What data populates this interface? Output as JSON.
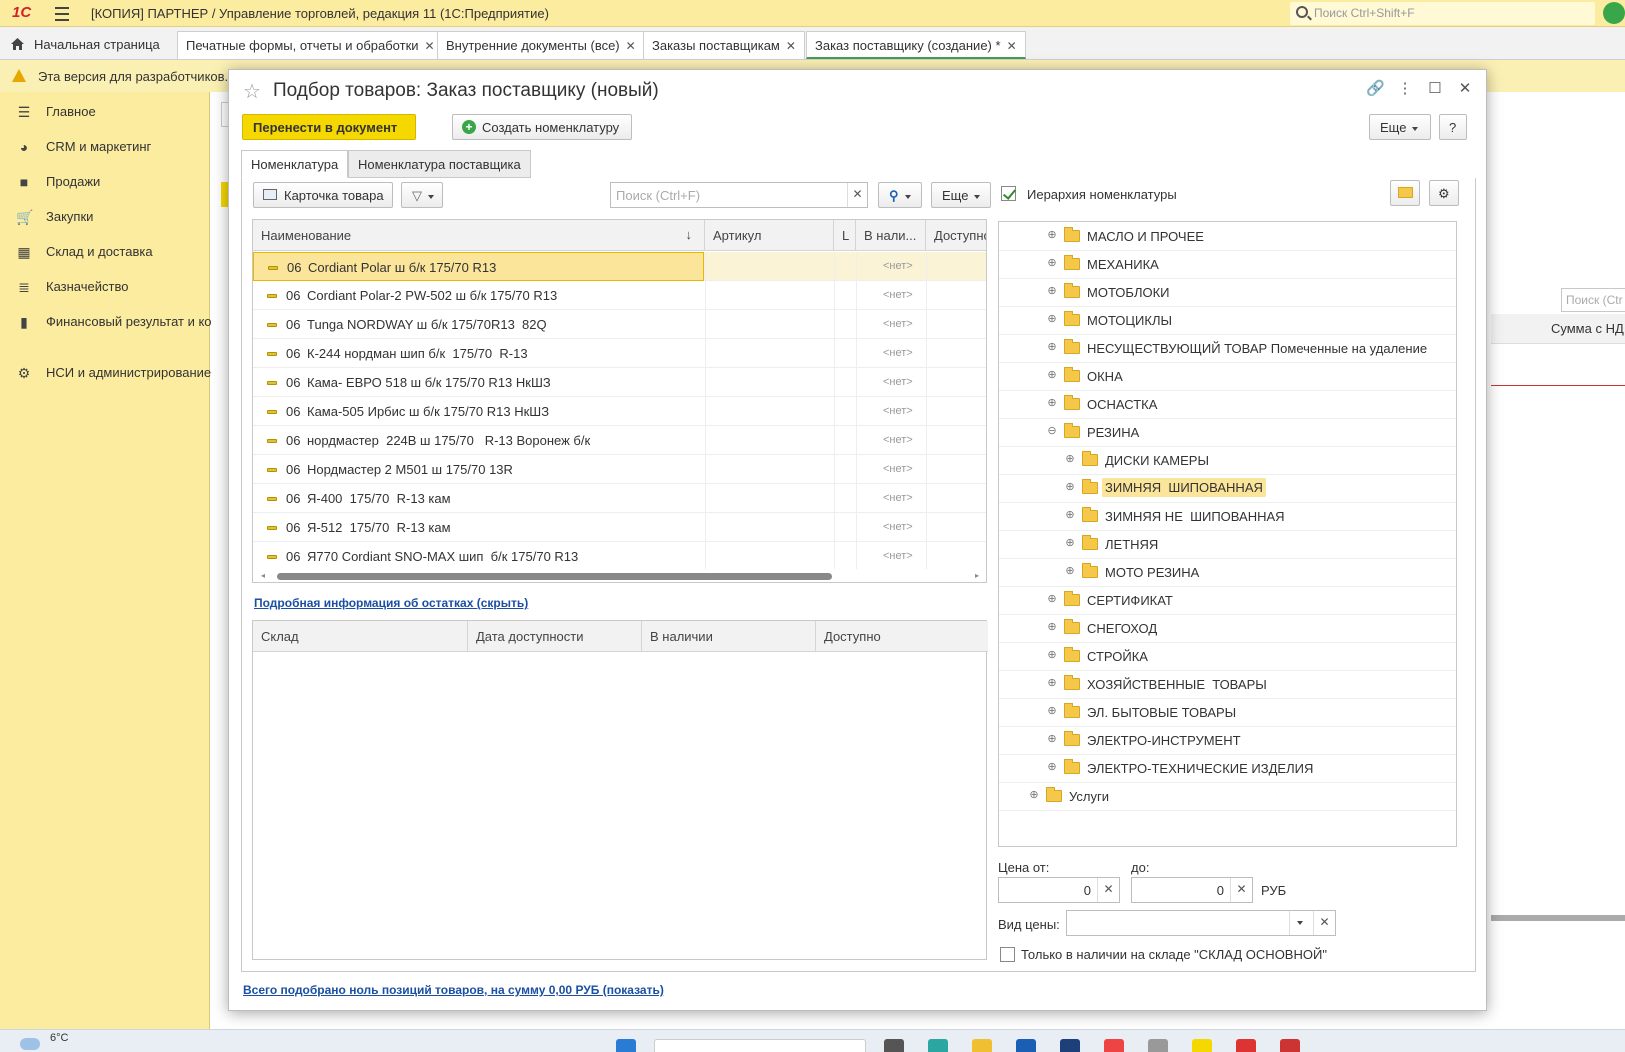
{
  "window": {
    "logo": "1С",
    "title": "[КОПИЯ] ПАРТНЕР / Управление торговлей, редакция 11  (1С:Предприятие)",
    "search_placeholder": "Поиск Ctrl+Shift+F"
  },
  "tabs": {
    "home": "Начальная страница",
    "items": [
      {
        "label": "Печатные формы, отчеты и обработки"
      },
      {
        "label": "Внутренние документы (все)"
      },
      {
        "label": "Заказы поставщикам"
      },
      {
        "label": "Заказ поставщику (создание) *"
      }
    ]
  },
  "dev_notice": "Эта версия для разработчиков.",
  "sidebar": {
    "items": [
      {
        "label": "Главное"
      },
      {
        "label": "CRM и маркетинг"
      },
      {
        "label": "Продажи"
      },
      {
        "label": "Закупки"
      },
      {
        "label": "Склад и доставка"
      },
      {
        "label": "Казначейство"
      },
      {
        "label": "Финансовый результат и контроллинг"
      },
      {
        "label": "НСИ и администрирование"
      }
    ]
  },
  "background": {
    "search_placeholder": "Поиск (Ctr",
    "column": "Сумма с НД"
  },
  "modal": {
    "title": "Подбор товаров: Заказ поставщику (новый)",
    "transfer_button": "Перенести в документ",
    "create_button": "Создать номенклатуру",
    "more_button": "Еще",
    "help_button": "?",
    "tabs": [
      "Номенклатура",
      "Номенклатура поставщика"
    ],
    "card_button": "Карточка товара",
    "search_placeholder": "Поиск (Ctrl+F)",
    "more2": "Еще",
    "hierarchy_label": "Иерархия номенклатуры",
    "grid": {
      "columns": [
        "Наименование",
        "Артикул",
        "L",
        "В нали...",
        "Доступно"
      ],
      "rows": [
        {
          "code": "06",
          "name": "Cordiant Polar ш б/к 175/70 R13",
          "stock": "<нет>"
        },
        {
          "code": "06",
          "name": "Cordiant Polar-2 PW-502 ш б/к 175/70 R13",
          "stock": "<нет>"
        },
        {
          "code": "06",
          "name": "Tunga NORDWAY ш б/к 175/70R13  82Q",
          "stock": "<нет>"
        },
        {
          "code": "06",
          "name": "К-244 нордман шип б/к  175/70  R-13",
          "stock": "<нет>"
        },
        {
          "code": "06",
          "name": "Кама- ЕВРО 518 ш б/к 175/70 R13 НкШЗ",
          "stock": "<нет>"
        },
        {
          "code": "06",
          "name": "Кама-505 Ирбис ш б/к 175/70 R13 НкШЗ",
          "stock": "<нет>"
        },
        {
          "code": "06",
          "name": "нордмастер  224В ш 175/70   R-13 Воронеж б/к",
          "stock": "<нет>"
        },
        {
          "code": "06",
          "name": "Нордмастер 2 М501 ш 175/70 13R",
          "stock": "<нет>"
        },
        {
          "code": "06",
          "name": "Я-400  175/70  R-13 кам",
          "stock": "<нет>"
        },
        {
          "code": "06",
          "name": "Я-512  175/70  R-13 кам",
          "stock": "<нет>"
        },
        {
          "code": "06",
          "name": "Я770 Cordiant SNO-MAX шип  б/к 175/70 R13",
          "stock": "<нет>"
        }
      ]
    },
    "stock_link": "Подробная информация об остатках (скрыть)",
    "stock_columns": [
      "Склад",
      "Дата доступности",
      "В наличии",
      "Доступно"
    ],
    "tree": [
      {
        "label": "МАСЛО И ПРОЧЕЕ",
        "level": 1,
        "state": "plus"
      },
      {
        "label": "МЕХАНИКА",
        "level": 1,
        "state": "plus"
      },
      {
        "label": "МОТОБЛОКИ",
        "level": 1,
        "state": "plus"
      },
      {
        "label": "МОТОЦИКЛЫ",
        "level": 1,
        "state": "plus"
      },
      {
        "label": "НЕСУЩЕСТВУЮЩИЙ ТОВАР Помеченные на удаление",
        "level": 1,
        "state": "plus"
      },
      {
        "label": "ОКНА",
        "level": 1,
        "state": "plus"
      },
      {
        "label": "ОСНАСТКА",
        "level": 1,
        "state": "plus"
      },
      {
        "label": "РЕЗИНА",
        "level": 1,
        "state": "minus"
      },
      {
        "label": "ДИСКИ КАМЕРЫ",
        "level": 2,
        "state": "plus"
      },
      {
        "label": "ЗИМНЯЯ  ШИПОВАННАЯ",
        "level": 2,
        "state": "plus",
        "selected": true
      },
      {
        "label": "ЗИМНЯЯ НЕ  ШИПОВАННАЯ",
        "level": 2,
        "state": "plus"
      },
      {
        "label": "ЛЕТНЯЯ",
        "level": 2,
        "state": "plus"
      },
      {
        "label": "МОТО РЕЗИНА",
        "level": 2,
        "state": "plus"
      },
      {
        "label": "СЕРТИФИКАТ",
        "level": 1,
        "state": "plus"
      },
      {
        "label": "СНЕГОХОД",
        "level": 1,
        "state": "plus"
      },
      {
        "label": "СТРОЙКА",
        "level": 1,
        "state": "plus"
      },
      {
        "label": "ХОЗЯЙСТВЕННЫЕ  ТОВАРЫ",
        "level": 1,
        "state": "plus"
      },
      {
        "label": "ЭЛ. БЫТОВЫЕ ТОВАРЫ",
        "level": 1,
        "state": "plus"
      },
      {
        "label": "ЭЛЕКТРО-ИНСТРУМЕНТ",
        "level": 1,
        "state": "plus"
      },
      {
        "label": "ЭЛЕКТРО-ТЕХНИЧЕСКИЕ ИЗДЕЛИЯ",
        "level": 1,
        "state": "plus"
      },
      {
        "label": "Услуги",
        "level": 0,
        "state": "plus"
      }
    ],
    "price_from_label": "Цена от:",
    "price_to_label": "до:",
    "price_from": "0",
    "price_to": "0",
    "currency": "РУБ",
    "price_type_label": "Вид цены:",
    "only_in_stock": "Только в наличии на складе \"СКЛАД ОСНОВНОЙ\"",
    "footer_link": "Всего подобрано ноль позиций товаров, на сумму 0,00 РУБ (показать)"
  },
  "taskbar": {
    "weather": "6°C"
  }
}
